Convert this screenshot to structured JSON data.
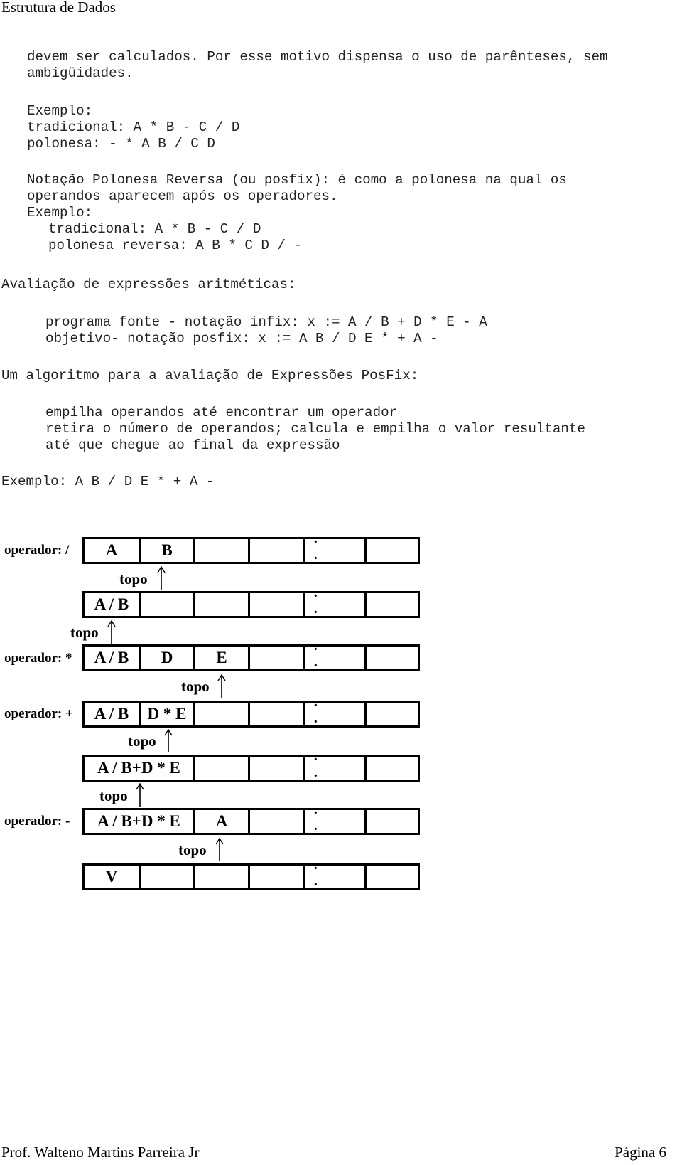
{
  "header": {
    "title": "Estrutura de Dados"
  },
  "body": {
    "p1": [
      "devem ser calculados. Por esse motivo dispensa o uso de parênteses, sem",
      "ambigüidades."
    ],
    "example1": {
      "label": "Exemplo:",
      "traditional": "tradicional: A * B - C / D",
      "polish": "polonesa: - * A B / C D"
    },
    "p2": [
      "Notação Polonesa Reversa (ou posfix): é como a polonesa na qual os",
      "operandos aparecem após os operadores."
    ],
    "example2": {
      "label": "Exemplo:",
      "traditional": "tradicional: A * B - C / D",
      "reverse_polish": "polonesa reversa: A B * C D / -"
    },
    "section_eval": "Avaliação de expressões aritméticas:",
    "eval_lines": [
      "programa fonte - notação infix: x := A / B + D * E - A",
      "objetivo- notação posfix: x := A B / D E * + A -"
    ],
    "section_algo": "Um algoritmo para a avaliação de Expressões PosFix:",
    "algo_lines": [
      "empilha operandos até encontrar um operador",
      "retira o número de operandos; calcula e empilha o valor resultante",
      "até que chegue ao final da expressão"
    ],
    "example3": "Exemplo: A B / D E * + A -"
  },
  "diagram": {
    "topo_label": "topo",
    "ellipsis": "· ·",
    "rows": [
      {
        "operator": "operador: /",
        "cells": [
          "A",
          "B",
          "",
          "",
          "· ·",
          ""
        ],
        "merged_first": false
      },
      {
        "operator": "",
        "cells": [
          "A / B",
          "",
          "",
          "",
          "· ·",
          ""
        ],
        "merged_first": false
      },
      {
        "operator": "operador: *",
        "cells": [
          "A / B",
          "D",
          "E",
          "",
          "· ·",
          ""
        ],
        "merged_first": false
      },
      {
        "operator": "operador: +",
        "cells": [
          "A / B",
          "D * E",
          "",
          "",
          "· ·",
          ""
        ],
        "merged_first": false
      },
      {
        "operator": "",
        "cells": [
          "A / B+D * E",
          "",
          "",
          "· ·",
          ""
        ],
        "merged_first": true
      },
      {
        "operator": "operador: -",
        "cells": [
          "A / B+D * E",
          "A",
          "",
          "· ·",
          ""
        ],
        "merged_first": true
      },
      {
        "operator": "",
        "cells": [
          "V",
          "",
          "",
          "",
          "· ·",
          ""
        ],
        "merged_first": false
      }
    ]
  },
  "footer": {
    "author": "Prof. Walteno Martins Parreira Jr",
    "page": "Página 6"
  }
}
